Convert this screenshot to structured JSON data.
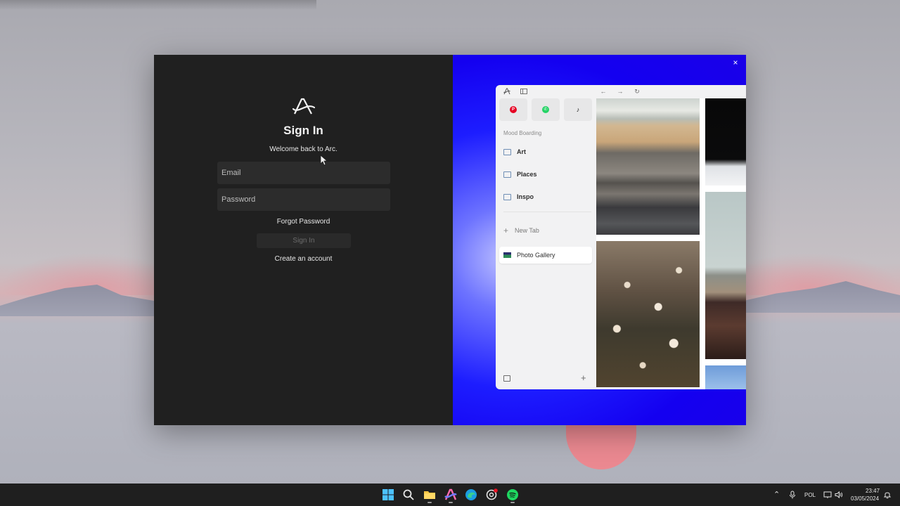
{
  "signin": {
    "title": "Sign In",
    "subtitle": "Welcome back to Arc.",
    "email_placeholder": "Email",
    "password_placeholder": "Password",
    "forgot_label": "Forgot Password",
    "signin_button": "Sign In",
    "create_account_label": "Create an account"
  },
  "promo": {
    "close_label": "×",
    "sidebar": {
      "favorites": [
        {
          "name": "pinterest-icon",
          "glyph": "P",
          "color": "#e60023"
        },
        {
          "name": "whatsapp-icon",
          "glyph": "✆",
          "color": "#25d366"
        },
        {
          "name": "tiktok-icon",
          "glyph": "♪",
          "color": "#111111"
        }
      ],
      "section_label": "Mood Boarding",
      "folders": [
        "Art",
        "Places",
        "Inspo"
      ],
      "new_tab_label": "New Tab",
      "active_tab_label": "Photo Gallery"
    }
  },
  "taskbar": {
    "language": "POL",
    "time": "23:47",
    "date": "03/05/2024"
  },
  "colors": {
    "accent_blue": "#1400f0",
    "signin_bg": "#202020"
  }
}
